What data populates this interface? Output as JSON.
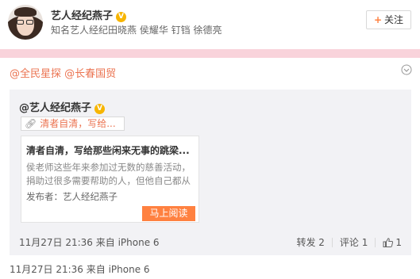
{
  "header": {
    "author_name": "艺人经纪燕子",
    "verified_badge": "V",
    "description": "知名艺人经纪田晓燕 侯耀华 钉铛 徐德亮",
    "follow_label": "关注"
  },
  "post": {
    "text": "@全民星探 @长春国贸"
  },
  "repost": {
    "author": "@艺人经纪燕子",
    "link_chip": "清者自清，写给...",
    "card": {
      "title": "清者自清，写给那些闲来无事的跳梁...",
      "body_line1": "侯老师这些年来参加过无数的慈善活动，",
      "body_line2": "捐助过很多需要帮助的人，但他自己都从",
      "publisher": "发布者：艺人经纪燕子",
      "read_button": "马上阅读"
    },
    "time": "11月27日 21:36",
    "source": "来自 iPhone 6",
    "actions": {
      "repost": "转发 2",
      "comment": "评论 1",
      "like": "1"
    }
  },
  "footer": {
    "time": "11月27日 21:36",
    "source": "来自 iPhone 6"
  },
  "colors": {
    "accent": "#eb7350",
    "button_orange": "#ff8140",
    "band_pink": "#f9d3db",
    "verified": "#f7b500"
  }
}
